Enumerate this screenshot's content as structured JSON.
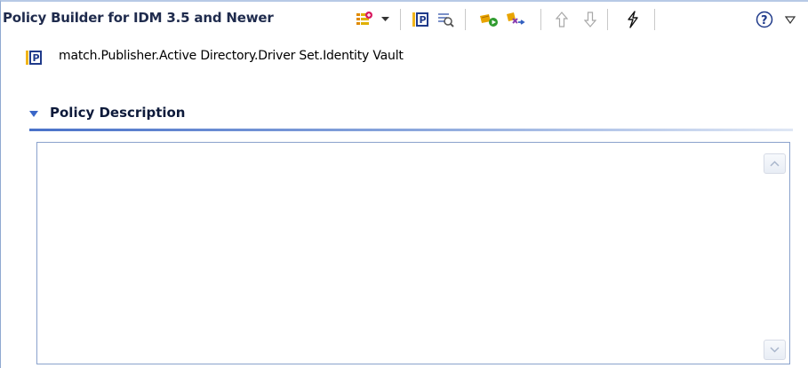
{
  "header": {
    "title": "Policy Builder for IDM 3.5 and Newer",
    "toolbar_icons": [
      "new-rule-icon",
      "dropdown-arrow-icon",
      "policy-icon",
      "find-icon",
      "run-icon",
      "step-icon",
      "move-up-icon",
      "move-down-icon",
      "trace-icon",
      "help-icon",
      "view-menu-icon"
    ]
  },
  "breadcrumb": {
    "icon": "policy-icon",
    "path": "match.Publisher.Active Directory.Driver Set.Identity Vault"
  },
  "section": {
    "title": "Policy Description",
    "description_value": "",
    "accent_color": "#3a66c8"
  }
}
